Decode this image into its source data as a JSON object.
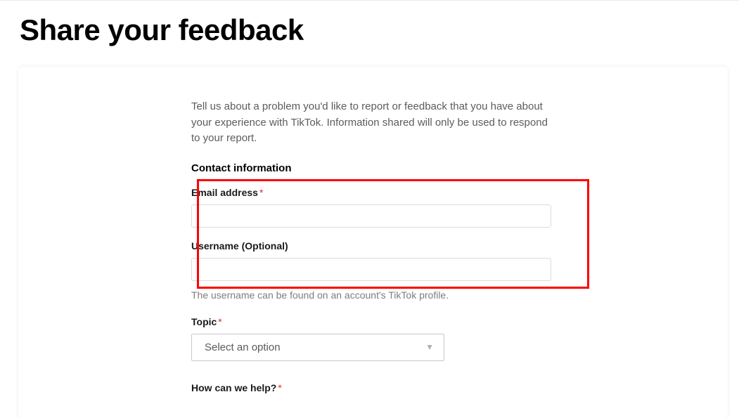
{
  "page": {
    "title": "Share your feedback"
  },
  "form": {
    "intro": "Tell us about a problem you'd like to report or feedback that you have about your experience with TikTok. Information shared will only be used to respond to your report.",
    "contact_heading": "Contact information",
    "email_label": "Email address",
    "username_label": "Username (Optional)",
    "username_help": "The username can be found on an account's TikTok profile.",
    "topic_label": "Topic",
    "topic_placeholder": "Select an option",
    "help_label": "How can we help?",
    "required_mark": "*"
  }
}
